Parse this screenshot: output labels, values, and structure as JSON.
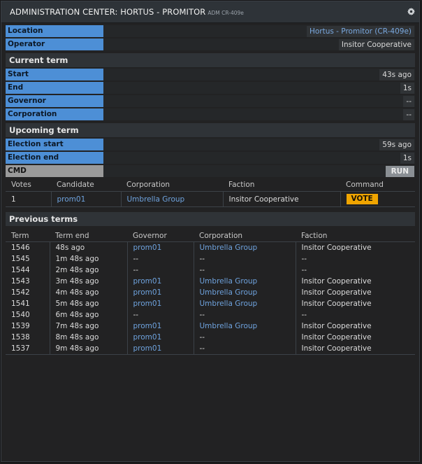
{
  "window": {
    "title": "ADMINISTRATION CENTER: HORTUS - PROMITOR",
    "subtitle": "ADM CR-409e"
  },
  "info": [
    {
      "label": "Location",
      "value": "Hortus - Promitor (CR-409e)",
      "link": true
    },
    {
      "label": "Operator",
      "value": "Insitor Cooperative",
      "link": false
    }
  ],
  "current_term": {
    "heading": "Current term",
    "rows": [
      {
        "label": "Start",
        "value": "43s ago"
      },
      {
        "label": "End",
        "value": "1s"
      },
      {
        "label": "Governor",
        "value": "--"
      },
      {
        "label": "Corporation",
        "value": "--"
      }
    ]
  },
  "upcoming_term": {
    "heading": "Upcoming term",
    "rows": [
      {
        "label": "Election start",
        "value": "59s ago"
      },
      {
        "label": "Election end",
        "value": "1s"
      }
    ],
    "cmd_label": "CMD",
    "run_label": "RUN"
  },
  "candidates": {
    "columns": [
      "Votes",
      "Candidate",
      "Corporation",
      "Faction",
      "Command"
    ],
    "rows": [
      {
        "votes": "1",
        "candidate": "prom01",
        "corporation": "Umbrella Group",
        "faction": "Insitor Cooperative",
        "command": "VOTE"
      }
    ]
  },
  "previous_terms": {
    "heading": "Previous terms",
    "columns": [
      "Term",
      "Term end",
      "Governor",
      "Corporation",
      "Faction"
    ],
    "rows": [
      {
        "term": "1546",
        "end": "48s ago",
        "governor": "prom01",
        "corporation": "Umbrella Group",
        "faction": "Insitor Cooperative"
      },
      {
        "term": "1545",
        "end": "1m 48s ago",
        "governor": "--",
        "corporation": "--",
        "faction": "--"
      },
      {
        "term": "1544",
        "end": "2m 48s ago",
        "governor": "--",
        "corporation": "--",
        "faction": "--"
      },
      {
        "term": "1543",
        "end": "3m 48s ago",
        "governor": "prom01",
        "corporation": "Umbrella Group",
        "faction": "Insitor Cooperative"
      },
      {
        "term": "1542",
        "end": "4m 48s ago",
        "governor": "prom01",
        "corporation": "Umbrella Group",
        "faction": "Insitor Cooperative"
      },
      {
        "term": "1541",
        "end": "5m 48s ago",
        "governor": "prom01",
        "corporation": "Umbrella Group",
        "faction": "Insitor Cooperative"
      },
      {
        "term": "1540",
        "end": "6m 48s ago",
        "governor": "--",
        "corporation": "--",
        "faction": "--"
      },
      {
        "term": "1539",
        "end": "7m 48s ago",
        "governor": "prom01",
        "corporation": "Umbrella Group",
        "faction": "Insitor Cooperative"
      },
      {
        "term": "1538",
        "end": "8m 48s ago",
        "governor": "prom01",
        "corporation": "--",
        "faction": "Insitor Cooperative"
      },
      {
        "term": "1537",
        "end": "9m 48s ago",
        "governor": "prom01",
        "corporation": "--",
        "faction": "Insitor Cooperative"
      }
    ]
  },
  "icons": {
    "settings": "gear-icon"
  },
  "colors": {
    "label_bg": "#4d8fd6",
    "link": "#6fa3de",
    "vote_button": "#f0a500",
    "cmd_bg": "#9a9a9a"
  }
}
